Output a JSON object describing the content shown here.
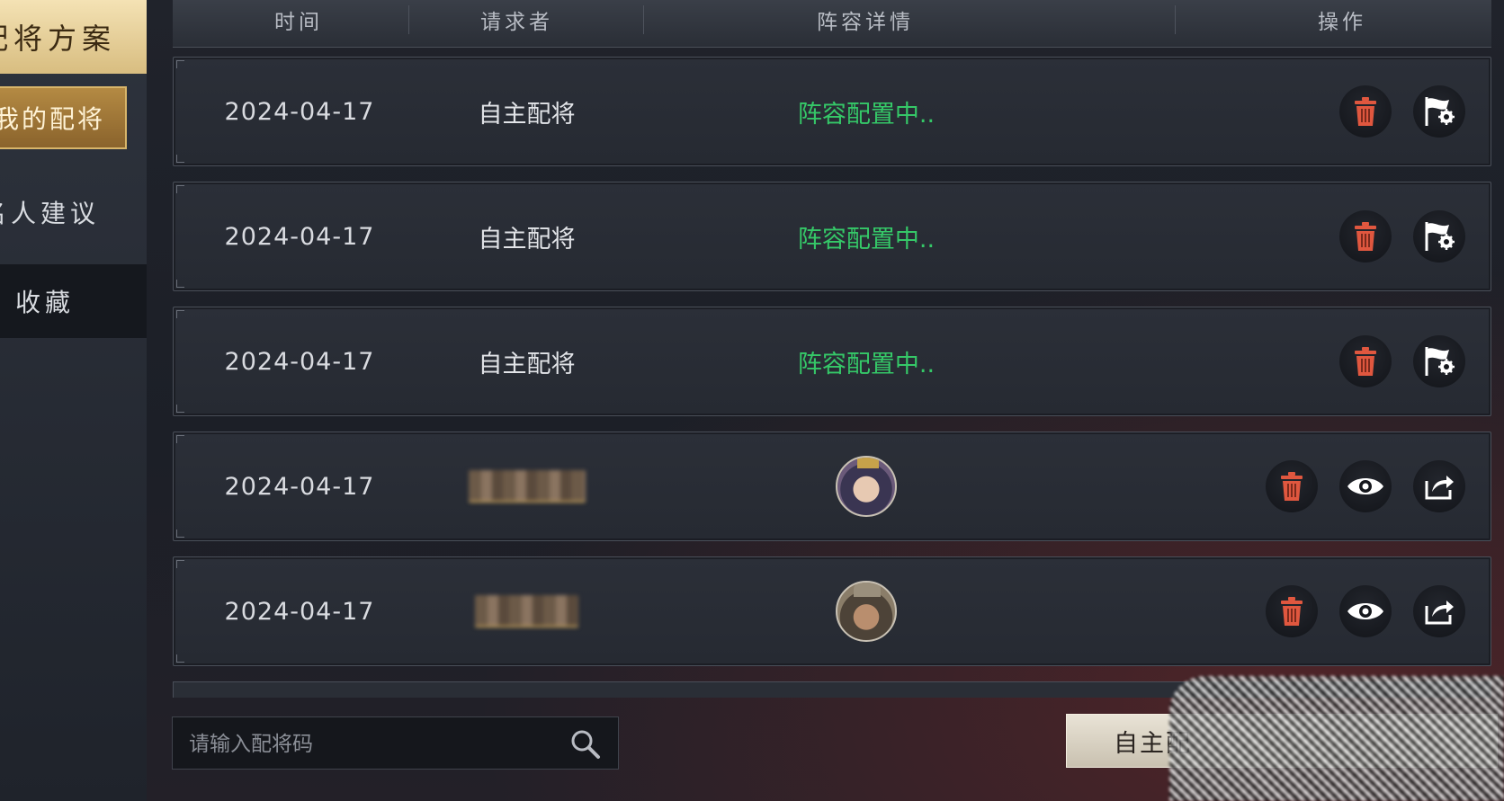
{
  "sidebar": {
    "items": [
      {
        "label": "配将方案"
      },
      {
        "label": "我的配将"
      },
      {
        "label": "名人建议"
      },
      {
        "label": "收藏"
      }
    ]
  },
  "table": {
    "headers": [
      "时间",
      "请求者",
      "阵容详情",
      "操作"
    ],
    "rows": [
      {
        "date": "2024-04-17",
        "requester": "自主配将",
        "detail": "阵容配置中.."
      },
      {
        "date": "2024-04-17",
        "requester": "自主配将",
        "detail": "阵容配置中.."
      },
      {
        "date": "2024-04-17",
        "requester": "自主配将",
        "detail": "阵容配置中.."
      },
      {
        "date": "2024-04-17",
        "requester": "",
        "detail": "",
        "avatar": "female-general-avatar"
      },
      {
        "date": "2024-04-17",
        "requester": "",
        "detail": "",
        "avatar": "male-general-avatar"
      }
    ]
  },
  "search": {
    "placeholder": "请输入配将码"
  },
  "footer": {
    "self_config_label": "自主配"
  },
  "colors": {
    "status_green": "#35c868",
    "delete_red": "#e0573f",
    "gold": "#d8b56a"
  },
  "icons": {
    "delete": "trash-icon",
    "configure": "flag-gear-icon",
    "view": "eye-icon",
    "share": "share-icon",
    "search": "search-icon"
  }
}
